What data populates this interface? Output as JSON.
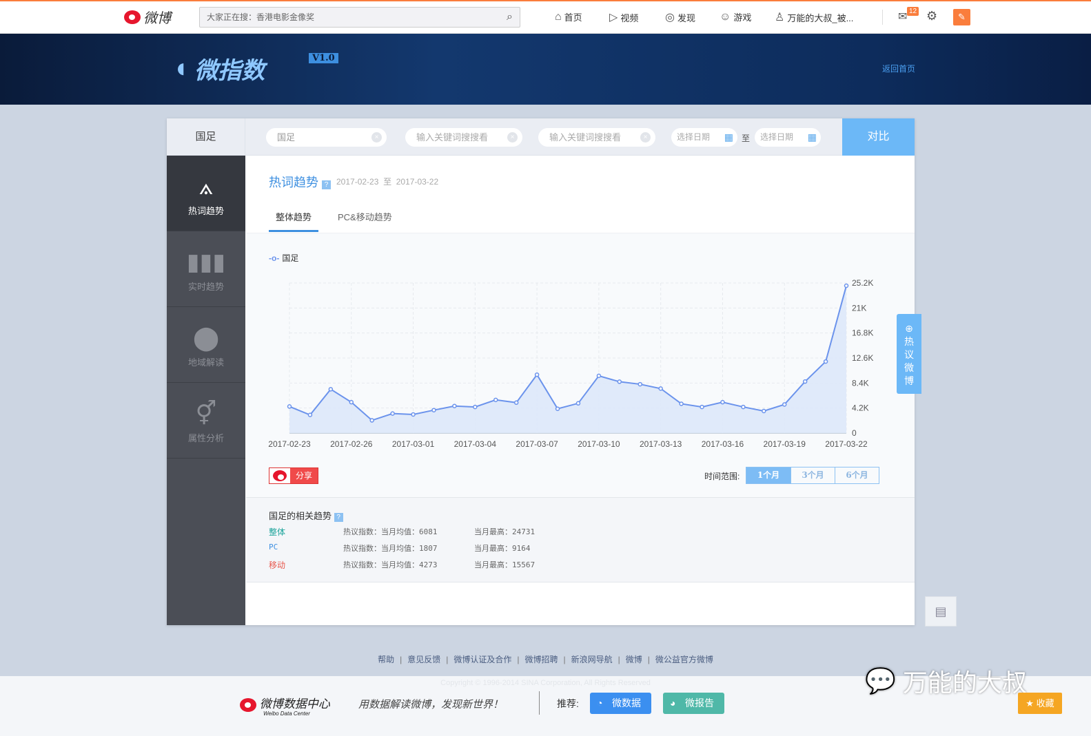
{
  "topbar": {
    "logo": "微博",
    "search_placeholder": "大家正在搜：香港电影金像奖",
    "nav": [
      {
        "icon": "home-icon",
        "label": "首页"
      },
      {
        "icon": "video-icon",
        "label": "视频"
      },
      {
        "icon": "compass-icon",
        "label": "发现"
      },
      {
        "icon": "gamepad-icon",
        "label": "游戏"
      },
      {
        "icon": "user-icon",
        "label": "万能的大叔_被..."
      }
    ],
    "mail_badge": "12"
  },
  "banner": {
    "title": "微指数",
    "version": "V1.0",
    "back_home": "返回首页"
  },
  "header": {
    "keyword": "国足",
    "inputs": [
      {
        "value": "国足"
      },
      {
        "placeholder": "输入关键词搜搜看"
      },
      {
        "placeholder": "输入关键词搜搜看"
      }
    ],
    "date_from": "选择日期",
    "date_to": "选择日期",
    "to": "至",
    "compare": "对比"
  },
  "sidebar": {
    "items": [
      {
        "label": "热词趋势",
        "active": true
      },
      {
        "label": "实时趋势"
      },
      {
        "label": "地域解读"
      },
      {
        "label": "属性分析"
      }
    ]
  },
  "main": {
    "title": "热词趋势",
    "help": "?",
    "date_start": "2017-02-23",
    "date_sep": "至",
    "date_end": "2017-03-22",
    "tabs": [
      {
        "label": "整体趋势",
        "active": true
      },
      {
        "label": "PC&移动趋势"
      }
    ],
    "share": "分享",
    "range_label": "时间范围:",
    "ranges": [
      "1个月",
      "3个月",
      "6个月"
    ],
    "hot_tab": "热议微博"
  },
  "chart_data": {
    "type": "area",
    "series": [
      {
        "name": "国足",
        "color": "#6b93ec",
        "values": [
          4460,
          3050,
          7360,
          5185,
          2135,
          3280,
          3125,
          3850,
          4540,
          4385,
          5570,
          5110,
          9800,
          4080,
          4995,
          9610,
          8620,
          8200,
          7470,
          4920,
          4385,
          5185,
          4385,
          3700,
          4800,
          8650,
          12010,
          24731
        ]
      }
    ],
    "x_start": "2017-02-23",
    "x_ticks": [
      "2017-02-23",
      "2017-02-26",
      "2017-03-01",
      "2017-03-04",
      "2017-03-07",
      "2017-03-10",
      "2017-03-13",
      "2017-03-16",
      "2017-03-19",
      "2017-03-22"
    ],
    "y_ticks": [
      "0",
      "4.2K",
      "8.4K",
      "12.6K",
      "16.8K",
      "21K",
      "25.2K"
    ],
    "ylim": [
      0,
      25200
    ],
    "grid": true,
    "legend": "top-left"
  },
  "related": {
    "title": "国足的相关趋势",
    "rows": [
      {
        "name": "整体",
        "color": "#1aa39a",
        "avg": "热议指数：当月均值：6081",
        "max": "当月最高：24731"
      },
      {
        "name": "PC",
        "color": "#3d8fe0",
        "avg": "热议指数：当月均值：1807",
        "max": "当月最高：9164"
      },
      {
        "name": "移动",
        "color": "#e8584d",
        "avg": "热议指数：当月均值：4273",
        "max": "当月最高：15567"
      }
    ]
  },
  "footer": {
    "links": [
      "帮助",
      "意见反馈",
      "微博认证及合作",
      "微博招聘",
      "新浪网导航",
      "微博",
      "微公益官方微博"
    ],
    "copyright": "Copyright © 1996-2014 SINA Corporation, All Rights Reserved",
    "brand": "微博数据中心",
    "brand_en": "Weibo Data Center",
    "slogan": "用数据解读微博，发现新世界！",
    "recommend": "推荐:",
    "btn1": "微数据",
    "btn2": "微报告",
    "watermark": "万能的大叔",
    "favorite": "收藏"
  }
}
